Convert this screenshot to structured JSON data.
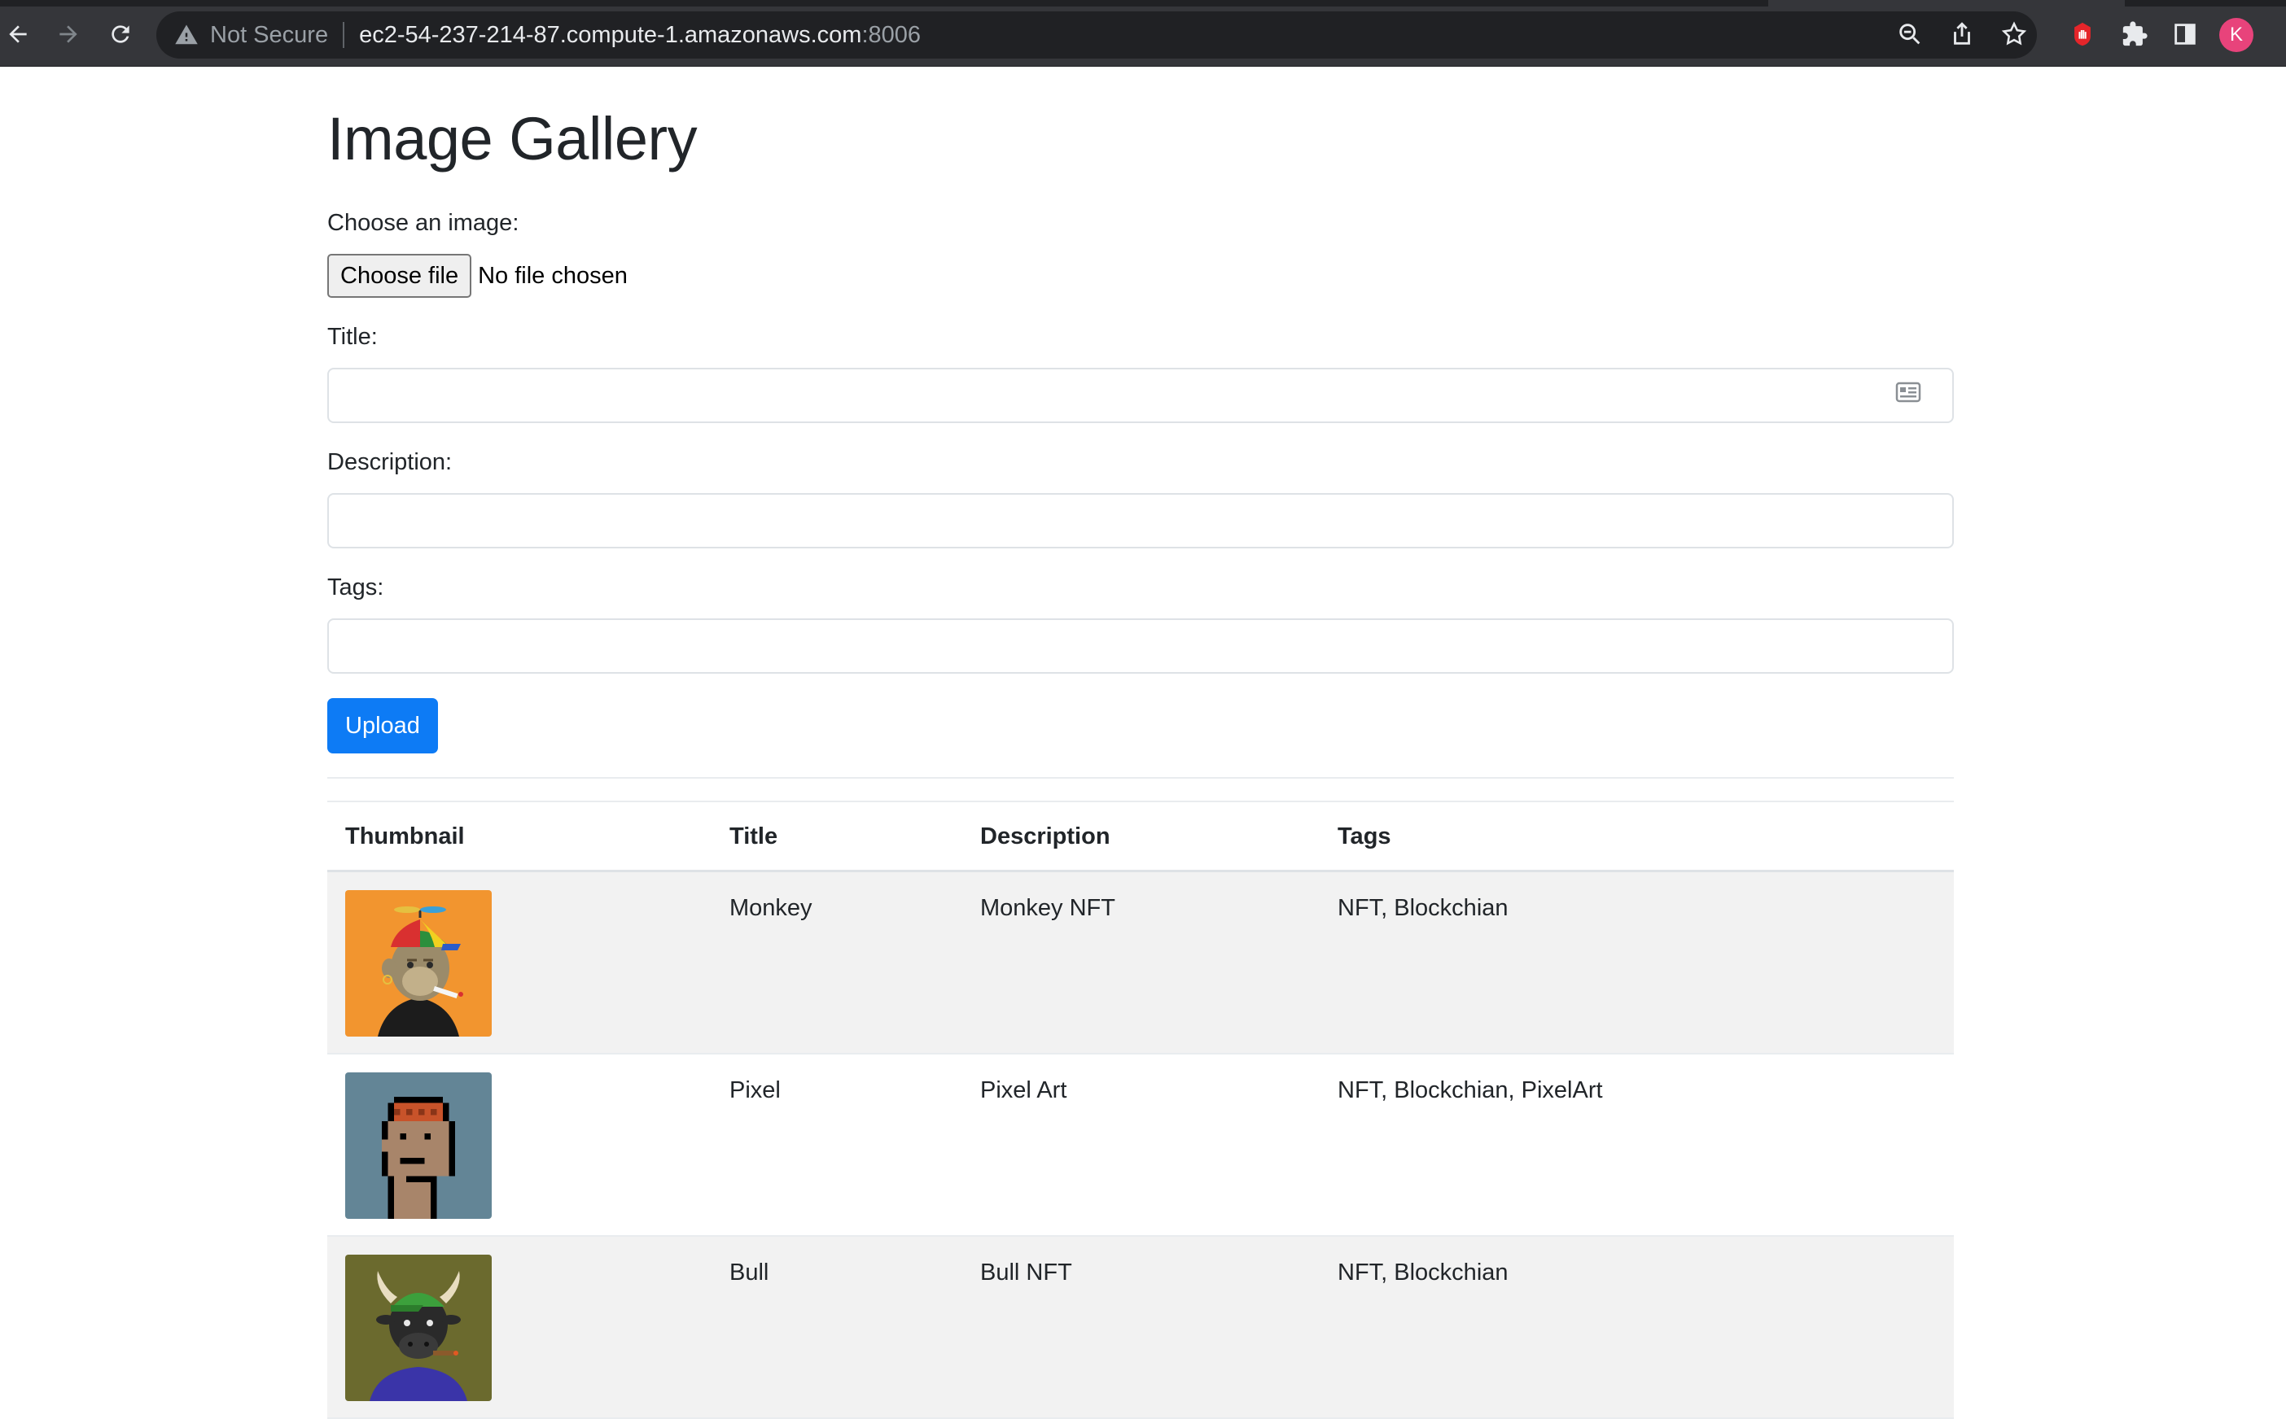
{
  "browser": {
    "security_label": "Not Secure",
    "url_host": "ec2-54-237-214-87.compute-1.amazonaws.com",
    "url_port": ":8006",
    "profile_initial": "K",
    "icons": [
      "back-arrow-icon",
      "forward-arrow-icon",
      "reload-icon",
      "warning-icon",
      "zoom-icon",
      "share-icon",
      "star-icon",
      "hand-stop-icon",
      "puzzle-icon",
      "side-panel-icon"
    ]
  },
  "page": {
    "title": "Image Gallery"
  },
  "form": {
    "image_label": "Choose an image:",
    "choose_file_label": "Choose file",
    "no_file_text": "No file chosen",
    "title_label": "Title:",
    "title_value": "",
    "description_label": "Description:",
    "description_value": "",
    "tags_label": "Tags:",
    "tags_value": "",
    "upload_label": "Upload"
  },
  "table": {
    "headers": {
      "thumbnail": "Thumbnail",
      "title": "Title",
      "description": "Description",
      "tags": "Tags"
    },
    "rows": [
      {
        "title": "Monkey",
        "description": "Monkey NFT",
        "tags": "NFT, Blockchian",
        "thumbnail": "monkey-nft-image"
      },
      {
        "title": "Pixel",
        "description": "Pixel Art",
        "tags": "NFT, Blockchian, PixelArt",
        "thumbnail": "pixel-nft-image"
      },
      {
        "title": "Bull",
        "description": "Bull NFT",
        "tags": "NFT, Blockchian",
        "thumbnail": "bull-nft-image"
      }
    ]
  },
  "colors": {
    "chrome_bg": "#35363a",
    "omnibox_bg": "#202124",
    "primary_button": "#0d7bf5",
    "stripe": "#f2f2f2",
    "avatar": "#e8437b"
  }
}
